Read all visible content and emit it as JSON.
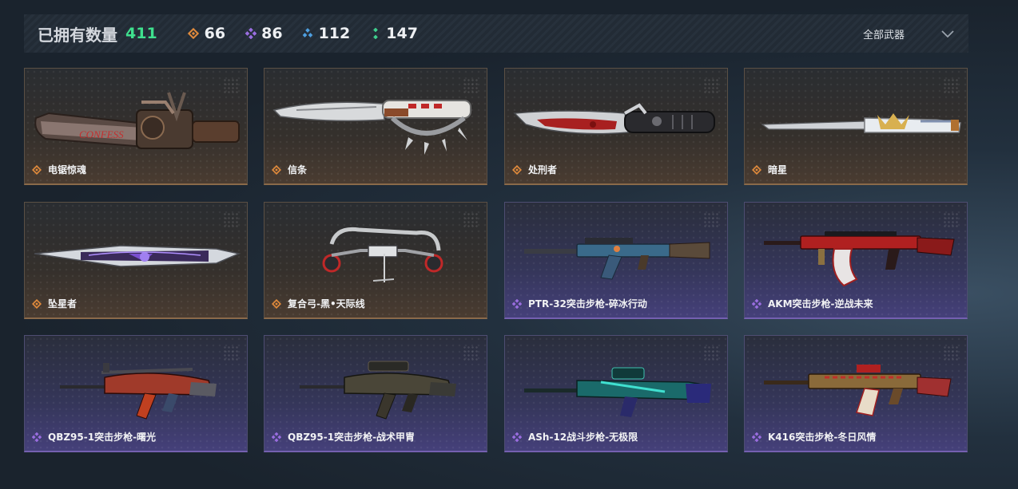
{
  "header": {
    "owned_label": "已拥有数量",
    "owned_total": "411",
    "counts": [
      {
        "icon": "orange-diamond-icon",
        "color": "#e08a3c",
        "value": "66"
      },
      {
        "icon": "purple-diamond-icon",
        "color": "#9a6ee0",
        "value": "86"
      },
      {
        "icon": "blue-diamond-icon",
        "color": "#4e9fe0",
        "value": "112"
      },
      {
        "icon": "green-diamond-icon",
        "color": "#3fd08e",
        "value": "147"
      }
    ],
    "filter_label": "全部武器",
    "filter_icon": "chevron-down-icon"
  },
  "colors": {
    "gold_rarity": "#e08a3c",
    "purple_rarity": "#9a6ee0",
    "accent_green": "#3fe08e"
  },
  "weapons": [
    {
      "name": "电锯惊魂",
      "rarity": "gold",
      "art": "chainsaw"
    },
    {
      "name": "信条",
      "rarity": "gold",
      "art": "knuckle-knife"
    },
    {
      "name": "处刑者",
      "rarity": "gold",
      "art": "blood-knife"
    },
    {
      "name": "暗星",
      "rarity": "gold",
      "art": "long-blade"
    },
    {
      "name": "坠星者",
      "rarity": "gold",
      "art": "star-blade"
    },
    {
      "name": "复合弓-黑•天际线",
      "rarity": "gold",
      "art": "compound-bow"
    },
    {
      "name": "PTR-32突击步枪-碎冰行动",
      "rarity": "purple",
      "art": "rifle-blue"
    },
    {
      "name": "AKM突击步枪-逆战未来",
      "rarity": "purple",
      "art": "rifle-red"
    },
    {
      "name": "QBZ95-1突击步枪-曙光",
      "rarity": "purple",
      "art": "bullpup-red"
    },
    {
      "name": "QBZ95-1突击步枪-战术甲胄",
      "rarity": "purple",
      "art": "bullpup-dark"
    },
    {
      "name": "ASh-12战斗步枪-无极限",
      "rarity": "purple",
      "art": "rifle-teal"
    },
    {
      "name": "K416突击步枪-冬日风情",
      "rarity": "purple",
      "art": "rifle-xmas"
    }
  ]
}
